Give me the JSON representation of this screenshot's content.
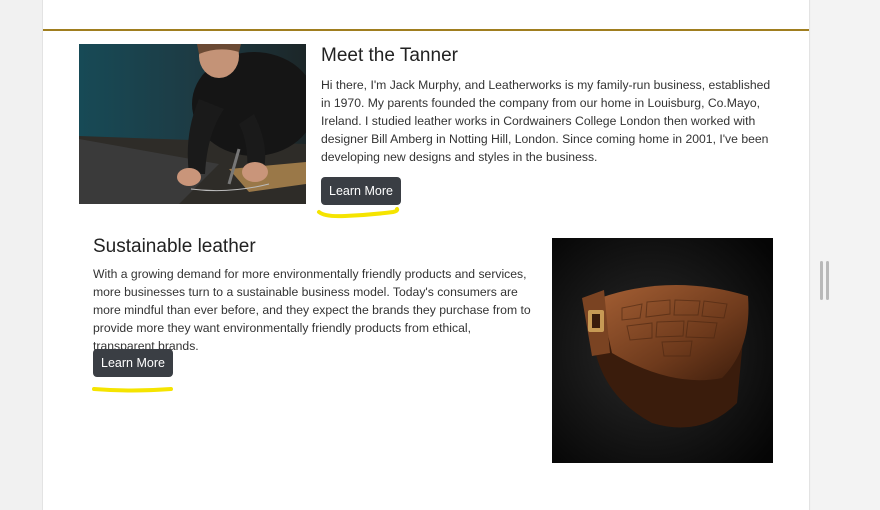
{
  "tanner": {
    "title": "Meet the Tanner",
    "text": "Hi there, I'm Jack Murphy, and Leatherworks is my family-run business, established in 1970. My parents founded the company from our home in Louisburg, Co.Mayo, Ireland. I studied leather works in Cordwainers College London then worked with designer Bill Amberg in Notting Hill, London. Since coming home in 2001, I've been developing new designs and styles in the business.",
    "button_label": "Learn More"
  },
  "sustainable": {
    "title": "Sustainable leather",
    "text": "With a growing demand for more environmentally friendly products and services, more businesses turn to a sustainable business model. Today's consumers are more mindful than ever before, and they expect the brands they purchase from to provide more they want environmentally friendly products from ethical, transparent brands.",
    "button_label": "Learn More"
  },
  "colors": {
    "accent_rule": "#a07e1f",
    "button_bg": "#3a3e44",
    "highlight": "#f5e400"
  }
}
